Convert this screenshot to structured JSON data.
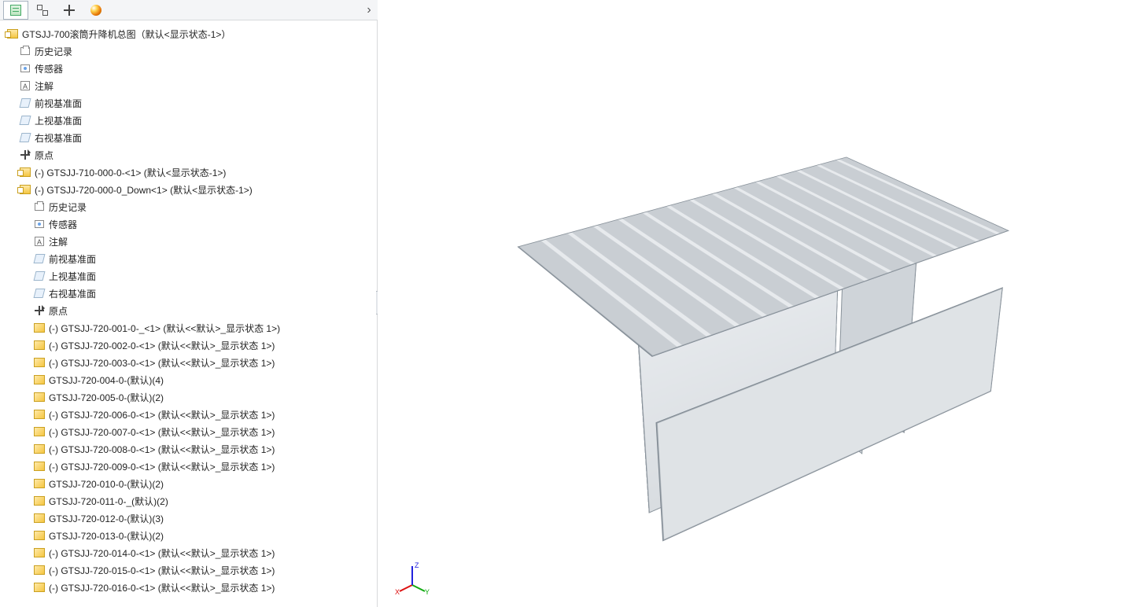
{
  "toolbar": {
    "tabs": [
      "feature-manager",
      "property-manager",
      "configuration-manager",
      "appearances"
    ]
  },
  "tree": {
    "root": "GTSJJ-700滚筒升降机总图（默认<显示状态-1>）",
    "std": {
      "history": "历史记录",
      "sensors": "传感器",
      "annotations": "注解",
      "front_plane": "前视基准面",
      "top_plane": "上视基准面",
      "right_plane": "右视基准面",
      "origin": "原点"
    },
    "sub1": "(-) GTSJJ-710-000-0-<1> (默认<显示状态-1>)",
    "sub2": "(-) GTSJJ-720-000-0_Down<1> (默认<显示状态-1>)",
    "sub2_std": {
      "history": "历史记录",
      "sensors": "传感器",
      "annotations": "注解",
      "front_plane": "前视基准面",
      "top_plane": "上视基准面",
      "right_plane": "右视基准面",
      "origin": "原点"
    },
    "parts": [
      "(-) GTSJJ-720-001-0-_<1> (默认<<默认>_显示状态 1>)",
      "(-) GTSJJ-720-002-0-<1> (默认<<默认>_显示状态 1>)",
      "(-) GTSJJ-720-003-0-<1> (默认<<默认>_显示状态 1>)",
      "GTSJJ-720-004-0-(默认)(4)",
      "GTSJJ-720-005-0-(默认)(2)",
      "(-) GTSJJ-720-006-0-<1> (默认<<默认>_显示状态 1>)",
      "(-) GTSJJ-720-007-0-<1> (默认<<默认>_显示状态 1>)",
      "(-) GTSJJ-720-008-0-<1> (默认<<默认>_显示状态 1>)",
      "(-) GTSJJ-720-009-0-<1> (默认<<默认>_显示状态 1>)",
      "GTSJJ-720-010-0-(默认)(2)",
      "GTSJJ-720-011-0-_(默认)(2)",
      "GTSJJ-720-012-0-(默认)(3)",
      "GTSJJ-720-013-0-(默认)(2)",
      "(-) GTSJJ-720-014-0-<1> (默认<<默认>_显示状态 1>)",
      "(-) GTSJJ-720-015-0-<1> (默认<<默认>_显示状态 1>)",
      "(-) GTSJJ-720-016-0-<1> (默认<<默认>_显示状态 1>)"
    ]
  },
  "triad": {
    "x": "X",
    "y": "Y",
    "z": "Z"
  }
}
